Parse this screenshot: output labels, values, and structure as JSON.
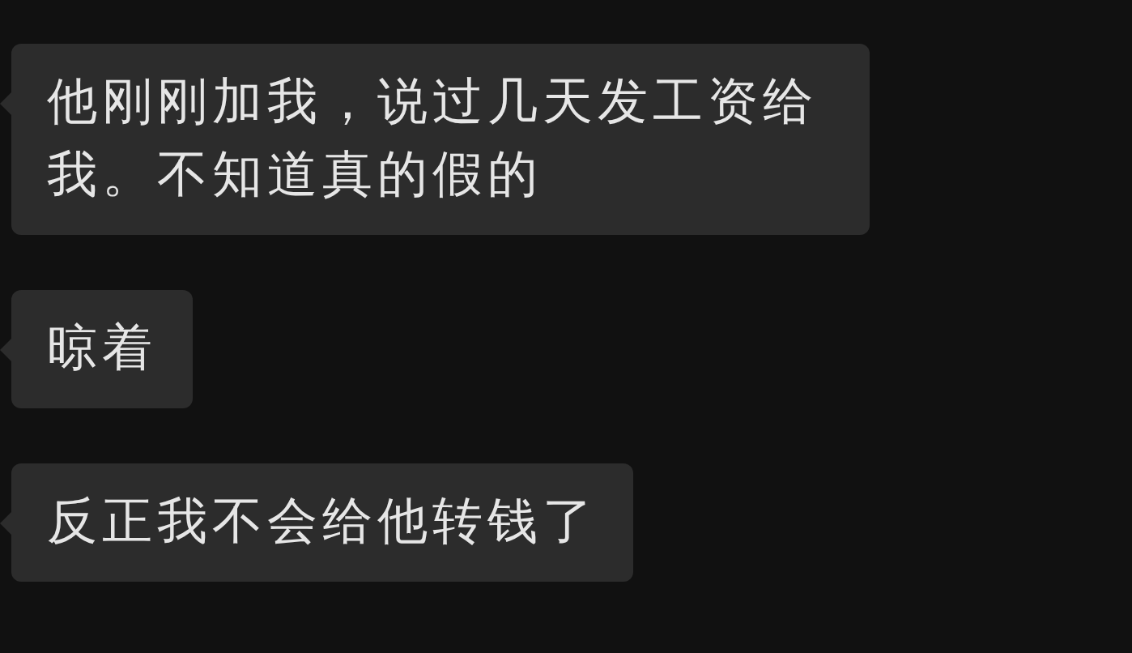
{
  "messages": [
    {
      "text": "他刚刚加我，说过几天发工资给我。不知道真的假的"
    },
    {
      "text": "晾着"
    },
    {
      "text": "反正我不会给他转钱了"
    }
  ]
}
